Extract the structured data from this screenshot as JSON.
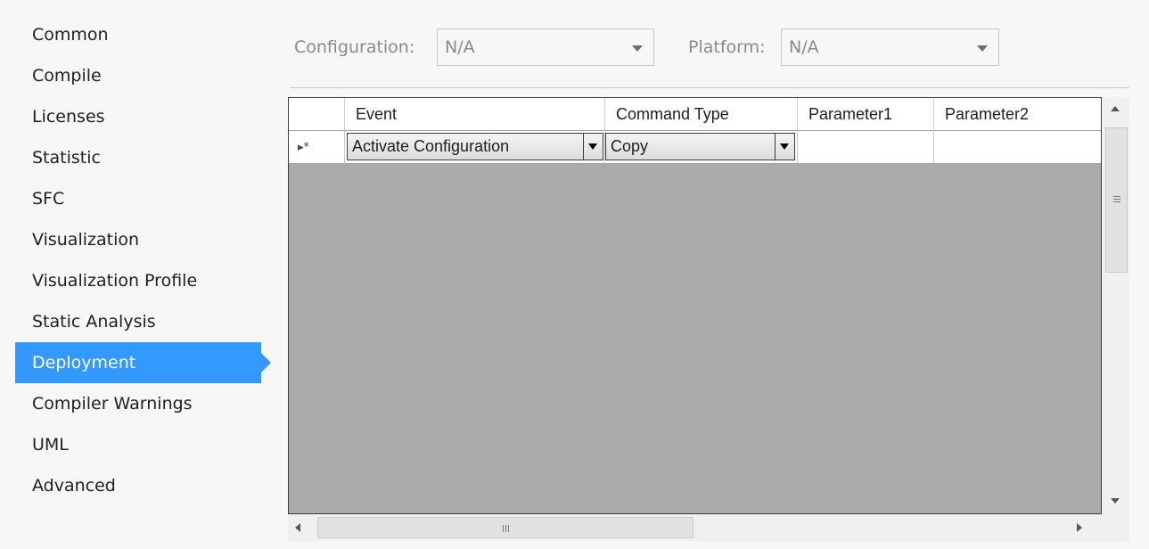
{
  "nav": {
    "items": [
      {
        "label": "Common"
      },
      {
        "label": "Compile"
      },
      {
        "label": "Licenses"
      },
      {
        "label": "Statistic"
      },
      {
        "label": "SFC"
      },
      {
        "label": "Visualization"
      },
      {
        "label": "Visualization Profile"
      },
      {
        "label": "Static Analysis"
      },
      {
        "label": "Deployment"
      },
      {
        "label": "Compiler Warnings"
      },
      {
        "label": "UML"
      },
      {
        "label": "Advanced"
      }
    ],
    "selected": "Deployment"
  },
  "topbar": {
    "configuration_label": "Configuration:",
    "configuration_value": "N/A",
    "platform_label": "Platform:",
    "platform_value": "N/A"
  },
  "grid": {
    "columns": [
      "Event",
      "Command Type",
      "Parameter1",
      "Parameter2"
    ],
    "new_row_marker": "▸*",
    "new_row": {
      "event": "Activate Configuration",
      "command_type": "Copy",
      "parameter1": "",
      "parameter2": ""
    }
  },
  "colors": {
    "selection": "#3399ff",
    "grid_background": "#ababab"
  },
  "icons": {
    "dropdown": "chevron-down-icon",
    "scroll_up": "scroll-up-arrow-icon",
    "scroll_down": "scroll-down-arrow-icon",
    "scroll_left": "scroll-left-arrow-icon",
    "scroll_right": "scroll-right-arrow-icon"
  }
}
